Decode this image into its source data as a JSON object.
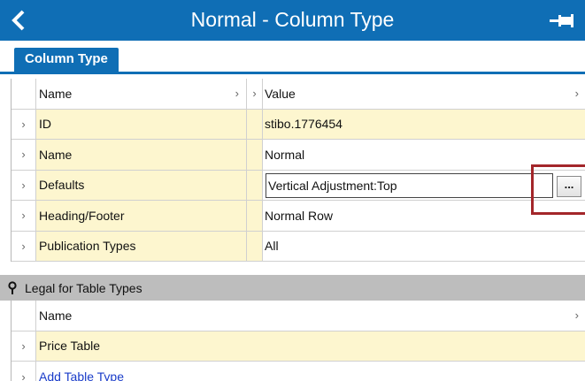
{
  "window": {
    "title": "Normal - Column Type",
    "back_icon": "chevron-left-icon",
    "pin_icon": "pin-icon",
    "accent_color": "#0f6eb5"
  },
  "tab": {
    "label": "Column Type"
  },
  "properties": {
    "header": {
      "name": "Name",
      "value": "Value"
    },
    "rows": [
      {
        "name": "ID",
        "value": "stibo.1776454"
      },
      {
        "name": "Name",
        "value": "Normal"
      },
      {
        "name": "Defaults",
        "value": "Vertical Adjustment:Top",
        "editing": true,
        "button": "..."
      },
      {
        "name": "Heading/Footer",
        "value": "Normal Row"
      },
      {
        "name": "Publication Types",
        "value": "All"
      }
    ]
  },
  "legal_section": {
    "label": "Legal for Table Types",
    "header": "Name",
    "rows": [
      {
        "name": "Price Table"
      }
    ],
    "add_link": "Add Table Type"
  }
}
